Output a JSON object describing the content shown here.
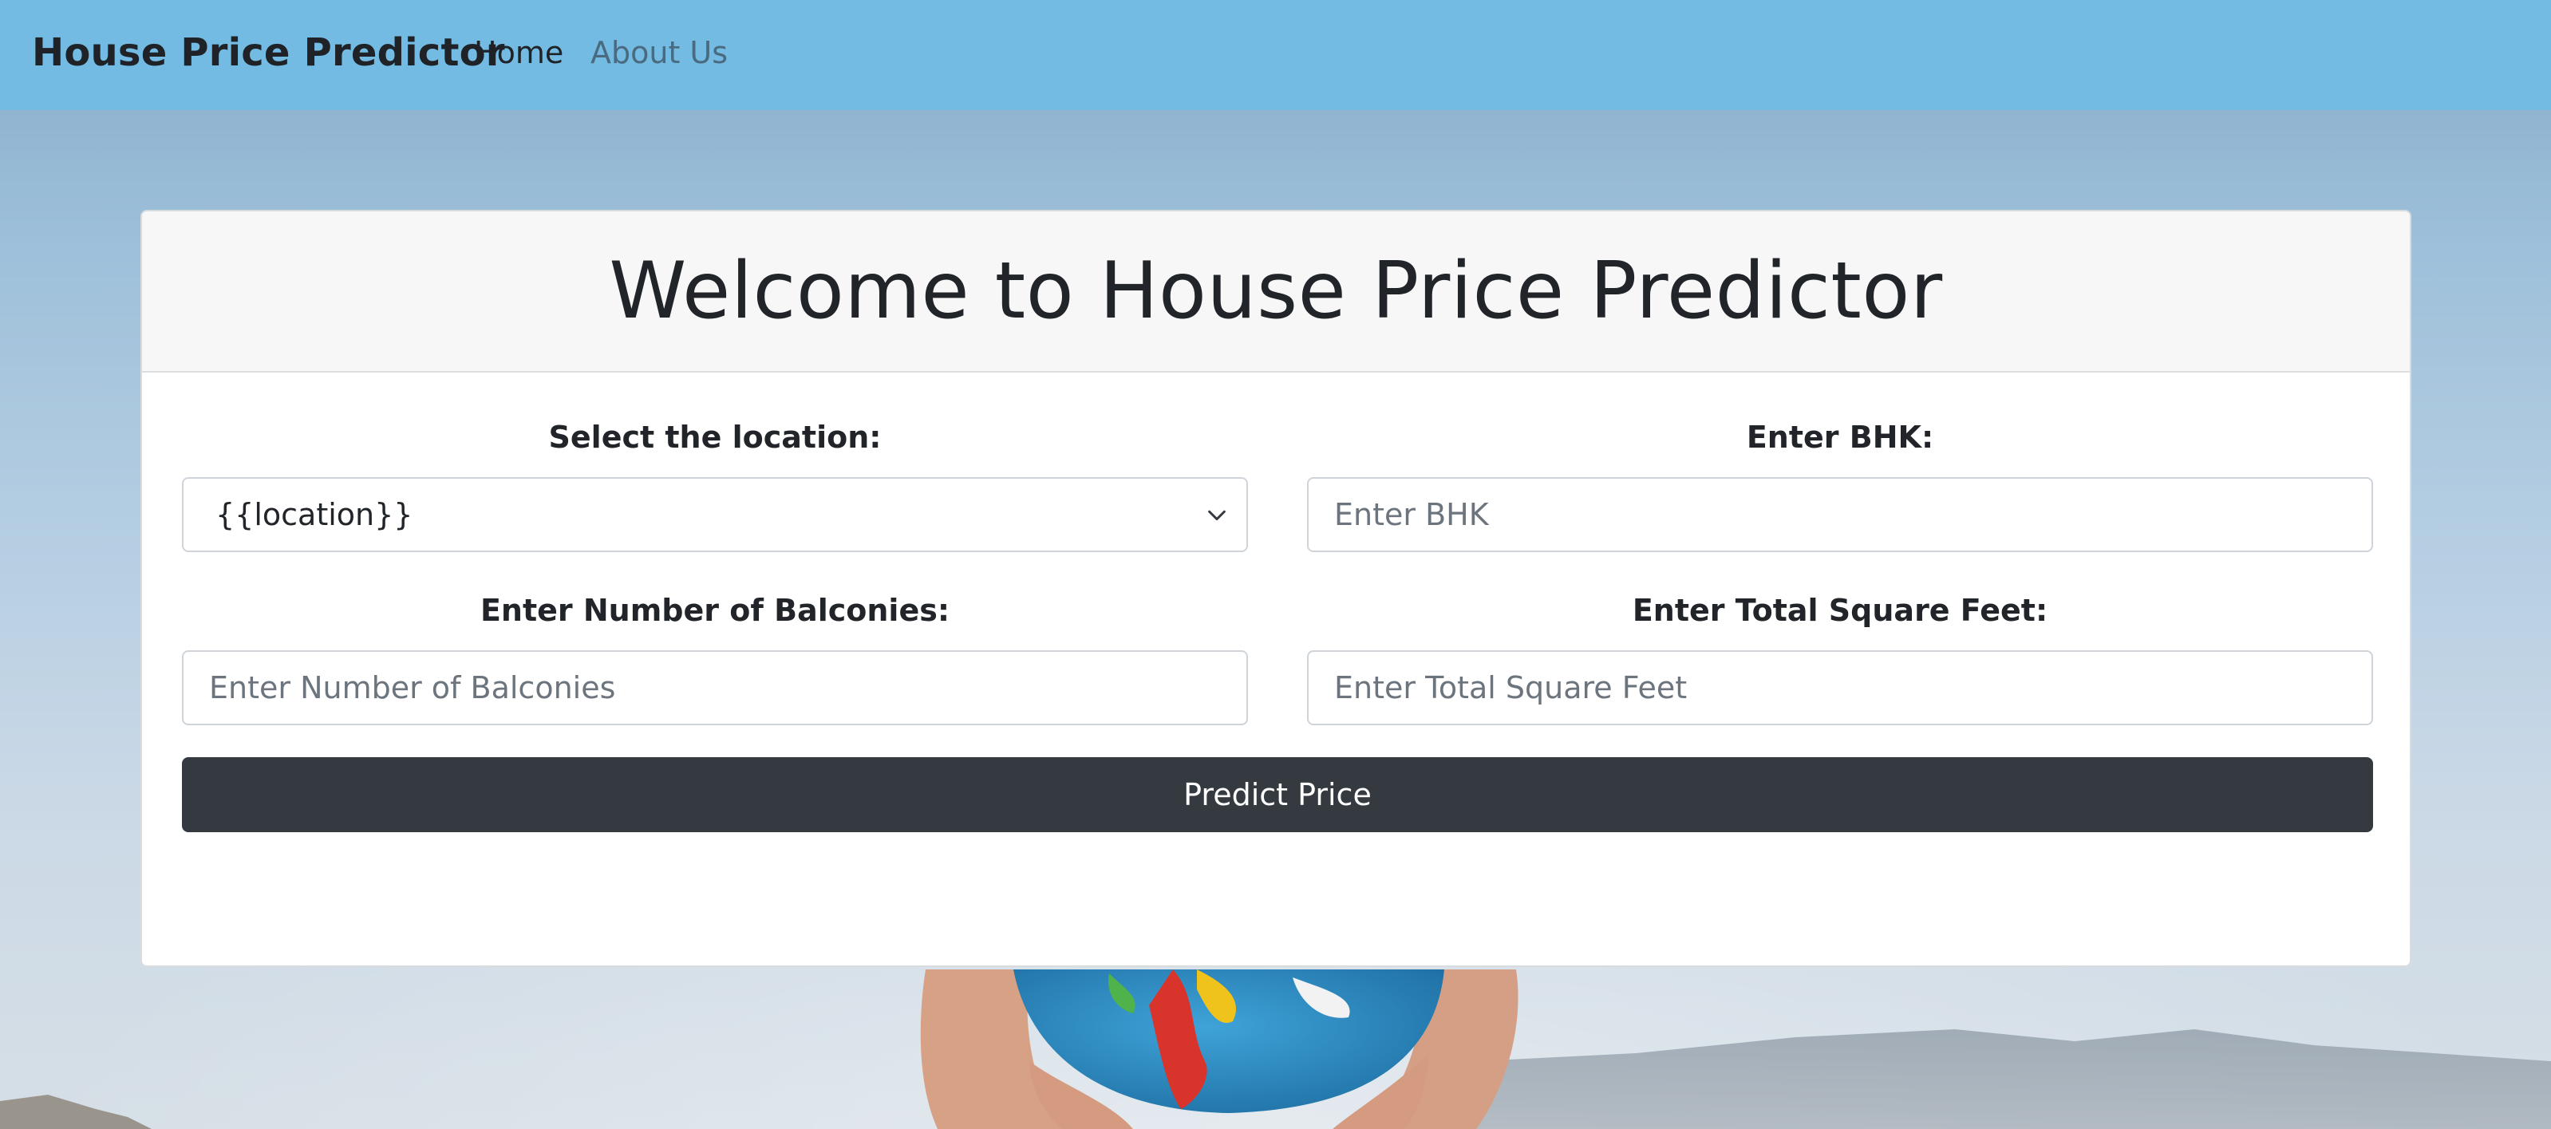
{
  "navbar": {
    "brand": "House Price Predictor",
    "links": [
      {
        "label": "Home"
      },
      {
        "label": "About Us"
      }
    ]
  },
  "card": {
    "title": "Welcome to House Price Predictor"
  },
  "form": {
    "location": {
      "label": "Select the location:",
      "selected": "{{location}}"
    },
    "bhk": {
      "label": "Enter BHK:",
      "placeholder": "Enter BHK"
    },
    "balconies": {
      "label": "Enter Number of Balconies:",
      "placeholder": "Enter Number of Balconies"
    },
    "sqft": {
      "label": "Enter Total Square Feet:",
      "placeholder": "Enter Total Square Feet"
    },
    "submit_label": "Predict Price"
  },
  "colors": {
    "navbar_bg": "#73bbe3",
    "button_bg": "#343a40",
    "card_header_bg": "#f7f7f7"
  }
}
